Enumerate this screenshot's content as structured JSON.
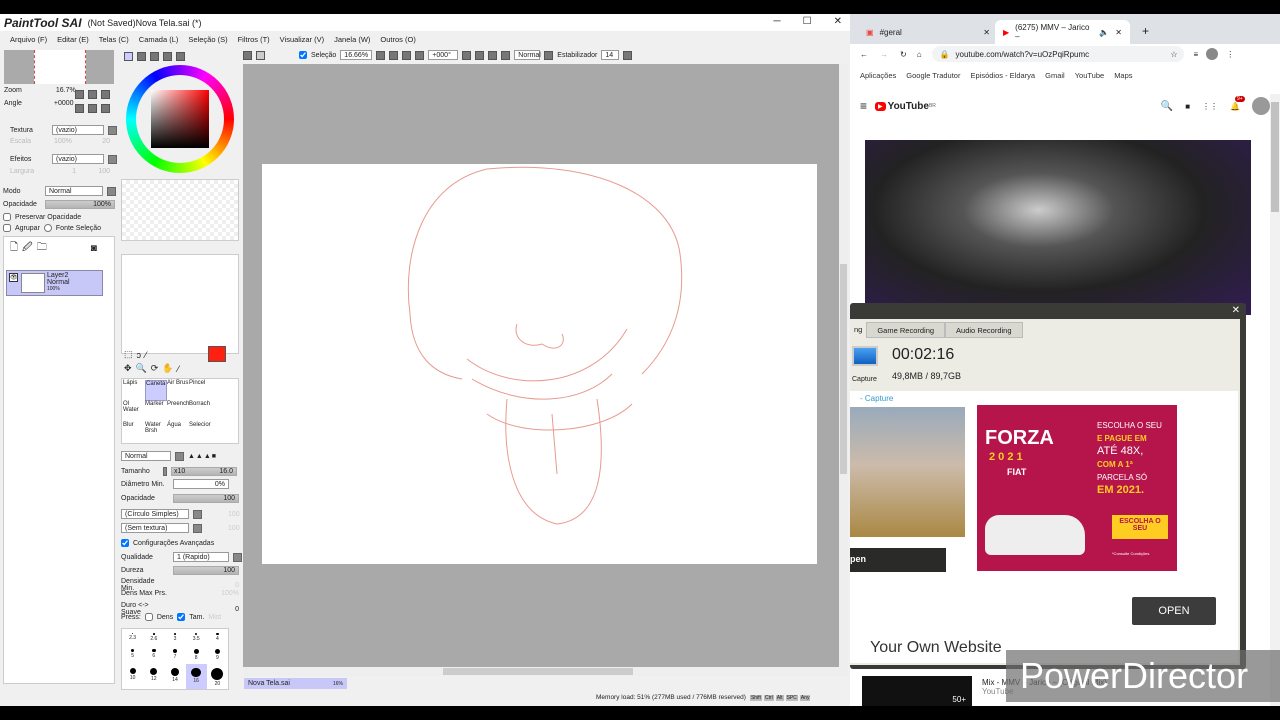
{
  "sai": {
    "app_name": "PaintTool SAI",
    "window_title": "(Not Saved)Nova Tela.sai (*)",
    "menu": [
      "Arquivo (F)",
      "Editar (E)",
      "Telas (C)",
      "Camada (L)",
      "Seleção (S)",
      "Filtros (T)",
      "Visualizar (V)",
      "Janela (W)",
      "Outros (O)"
    ],
    "toolbar": {
      "selection_label": "Seleção",
      "zoom": "16.66%",
      "angle": "+000°",
      "mode": "Normal",
      "stabilizer_label": "Estabilizador",
      "stabilizer": "14"
    },
    "navigator": {
      "zoom_label": "Zoom",
      "zoom_value": "16.7%",
      "angle_label": "Angle",
      "angle_value": "+0000"
    },
    "layer_panel": {
      "texture_label": "Textura",
      "texture_value": "(vazio)",
      "scale_label": "Escala",
      "scale_value": "100%",
      "scale_num": "20",
      "effects_label": "Efeitos",
      "effects_value": "(vazio)",
      "width_label": "Largura",
      "width_value": "1",
      "width_num": "100",
      "mode_label": "Modo",
      "mode_value": "Normal",
      "opacity_label": "Opacidade",
      "opacity_value": "100%",
      "preserve_opacity": "Preservar Opacidade",
      "group": "Agrupar",
      "selection_source": "Fonte Seleção",
      "layer": {
        "name": "Layer2",
        "mode": "Normal",
        "opacity": "100%"
      }
    },
    "tools": {
      "brushes": [
        "Lápis",
        "Caneta",
        "Air Brus",
        "Pincel",
        "Ol Water",
        "Marker",
        "Preench",
        "Borrach",
        "Blur",
        "Water Brsh",
        "Água",
        "Selecior"
      ],
      "selected_brush": "Caneta",
      "blend_mode": "Normal",
      "size_label": "Tamanho",
      "size_mult": "x10",
      "size_value": "16.0",
      "min_diam_label": "Diâmetro Min.",
      "min_diam_value": "0%",
      "density_label": "Opacidade",
      "density_value": "100",
      "shape": "(Círculo Simples)",
      "shape_value": "100",
      "texture": "(Sem textura)",
      "texture_value": "100",
      "advanced": "Configurações Avançadas",
      "quality_label": "Qualidade",
      "quality_value": "1 (Rapido)",
      "hardness_label": "Dureza",
      "hardness_value": "100",
      "min_density_label": "Densidade Min.",
      "min_density_value": "0",
      "max_dens_label": "Dens Max Prs.",
      "max_dens_value": "100%",
      "hard_soft_label": "Duro <-> Suave",
      "hard_soft_value": "0",
      "press_label": "Press:",
      "press_dens": "Dens",
      "press_size": "Tam.",
      "press_mix": "Mist",
      "sizes": [
        "2.3",
        "2.6",
        "3",
        "3.5",
        "4",
        "5",
        "6",
        "7",
        "8",
        "9",
        "10",
        "12",
        "14",
        "16",
        "20"
      ],
      "selected_size": "16"
    },
    "primary_color": "#ff2010",
    "canvas_tab": {
      "name": "Nova Tela.sai",
      "zoom": "16%"
    },
    "status": {
      "memory": "Memory load: 51% (277MB used / 776MB reserved)",
      "keys": [
        "Shift",
        "Ctrl",
        "Alt",
        "SPC",
        "Any"
      ]
    }
  },
  "chrome": {
    "tabs": [
      {
        "title": "#geral"
      },
      {
        "title": "(6275) MMV – Jarico –"
      }
    ],
    "url": "youtube.com/watch?v=uOzPqiRpumc",
    "bookmarks": [
      "Aplicações",
      "Google Tradutor",
      "Episódios - Eldarya",
      "Gmail",
      "YouTube",
      "Maps"
    ],
    "youtube": {
      "logo": "YouTube",
      "region": "BR",
      "notif": "9+"
    },
    "next_video": {
      "title": "Mix - MMV – Jarico – (Original Mix)",
      "channel": "YouTube",
      "count": "50+"
    }
  },
  "recorder": {
    "tabs": [
      "ng",
      "Game Recording",
      "Audio Recording"
    ],
    "time": "00:02:16",
    "size": "49,8MB / 89,7GB",
    "capture_label": "Capture",
    "link": "- Capture",
    "open_small": "pen",
    "open_button": "OPEN",
    "bottom_text": "Your Own Website",
    "ad": {
      "brand": "FORZA",
      "year": "2 0 2 1",
      "make": "FIAT",
      "l1": "ESCOLHA O SEU",
      "l2": "E PAGUE EM",
      "l3": "ATÉ 48X,",
      "l4": "COM A 1ª",
      "l5": "PARCELA SÓ",
      "l6": "EM 2021.",
      "cta": "ESCOLHA O SEU",
      "note": "*Consulte Condições"
    }
  },
  "watermark": "PowerDirector"
}
